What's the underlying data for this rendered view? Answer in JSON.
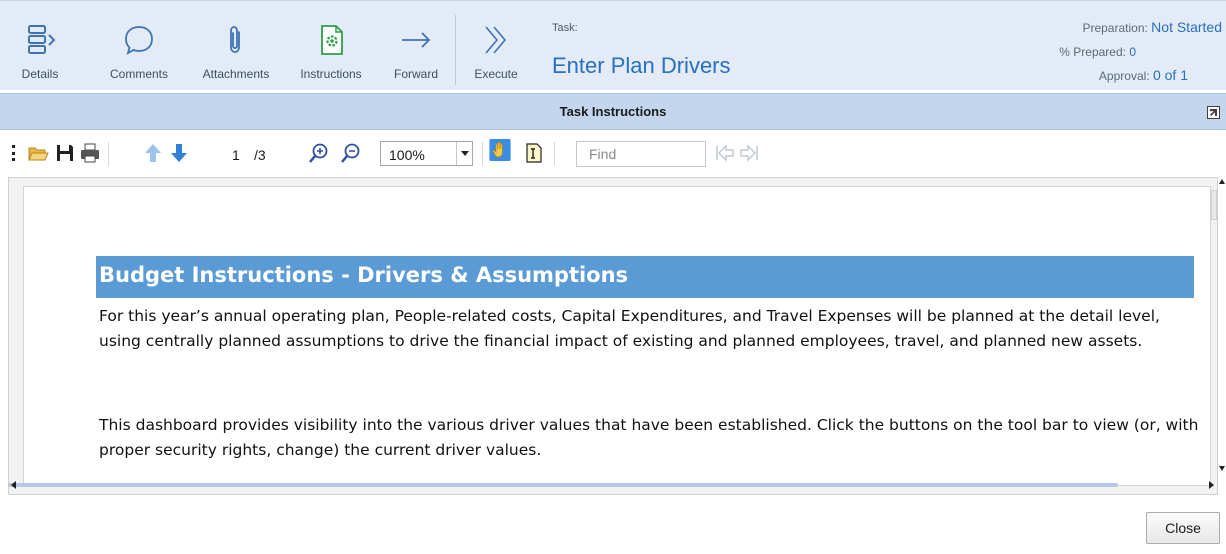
{
  "ribbon": {
    "buttons": [
      {
        "label": "Details",
        "icon": "details-icon"
      },
      {
        "label": "Comments",
        "icon": "comment-bubble-icon"
      },
      {
        "label": "Attachments",
        "icon": "paperclip-icon"
      },
      {
        "label": "Instructions",
        "icon": "instructions-document-icon"
      },
      {
        "label": "Forward",
        "icon": "arrow-right-icon"
      },
      {
        "label": "Execute",
        "icon": "double-chevron-right-icon"
      }
    ],
    "task_label": "Task:",
    "task_title": "Enter Plan Drivers",
    "meta": {
      "preparation_label": "Preparation:",
      "preparation_value": "Not Started",
      "prepared_label": "% Prepared:",
      "prepared_value": "0",
      "approval_label": "Approval:",
      "approval_value": "0 of 1"
    }
  },
  "panel": {
    "title": "Task Instructions",
    "popout_icon": "popout-icon"
  },
  "toolbar": {
    "current_page": "1",
    "page_total": "/3",
    "zoom_value": "100%",
    "find_placeholder": "Find",
    "icons": [
      "open-folder-icon",
      "save-icon",
      "print-icon",
      "previous-page-icon",
      "next-page-icon",
      "zoom-in-icon",
      "zoom-out-icon",
      "hand-tool-icon",
      "text-select-icon",
      "find-previous-icon",
      "find-next-icon"
    ]
  },
  "document": {
    "heading": "Budget Instructions - Drivers & Assumptions",
    "paragraph1": "For this year’s annual operating plan, People-related costs, Capital Expenditures, and Travel Expenses will be planned at the detail level, using centrally planned assumptions to drive the financial impact of existing and planned employees, travel, and planned new assets.",
    "paragraph2": "This dashboard provides visibility into the various driver values that have been established.  Click the buttons on the tool bar to view (or, with proper security rights, change) the current driver values."
  },
  "footer": {
    "close_label": "Close"
  },
  "colors": {
    "ribbon_bg": "#e2ebf6",
    "band_bg": "#c3d6ee",
    "accent_blue": "#2a6fc0",
    "heading_bg": "#5b9bd5"
  }
}
